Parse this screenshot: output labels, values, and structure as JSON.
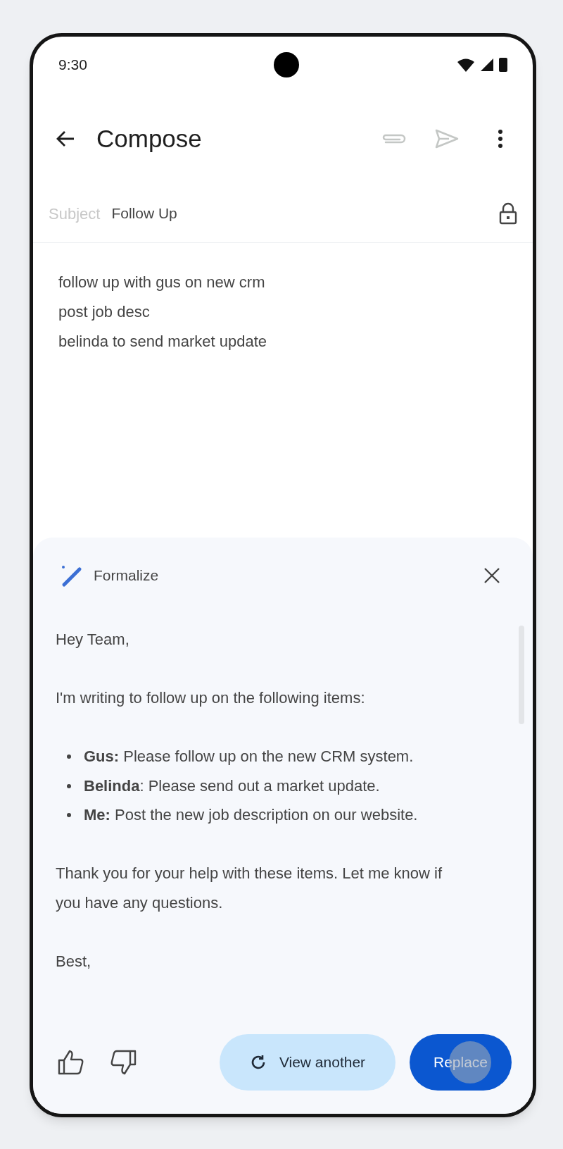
{
  "status_bar": {
    "time": "9:30"
  },
  "header": {
    "title": "Compose",
    "actions": [
      {
        "kind": "attach",
        "disabled": true
      },
      {
        "kind": "send",
        "disabled": true
      },
      {
        "kind": "more",
        "disabled": false
      }
    ]
  },
  "subject": {
    "label": "Subject",
    "value": "Follow Up"
  },
  "body": {
    "lines": [
      "follow up with gus on new crm",
      "post job desc",
      "belinda to send market update"
    ]
  },
  "suggestion": {
    "title": "Formalize",
    "blocks": [
      {
        "kind": "paragraph",
        "text": "Hey Team,"
      },
      {
        "kind": "paragraph",
        "text": "I'm writing to follow up on the following items:"
      },
      {
        "kind": "list",
        "items": [
          "**Gus:** Please follow up on the new CRM system.",
          "**Belinda**: Please send out a market update.",
          "**Me:** Post the new job description on our website."
        ]
      },
      {
        "kind": "paragraph",
        "text": "Thank you for your help with these items. Let me know if you have any questions."
      },
      {
        "kind": "paragraph",
        "text": "Best,"
      }
    ],
    "buttons": [
      {
        "kind": "secondary",
        "label": "View another"
      },
      {
        "kind": "primary",
        "label": "Replace",
        "pressed": true
      }
    ]
  }
}
